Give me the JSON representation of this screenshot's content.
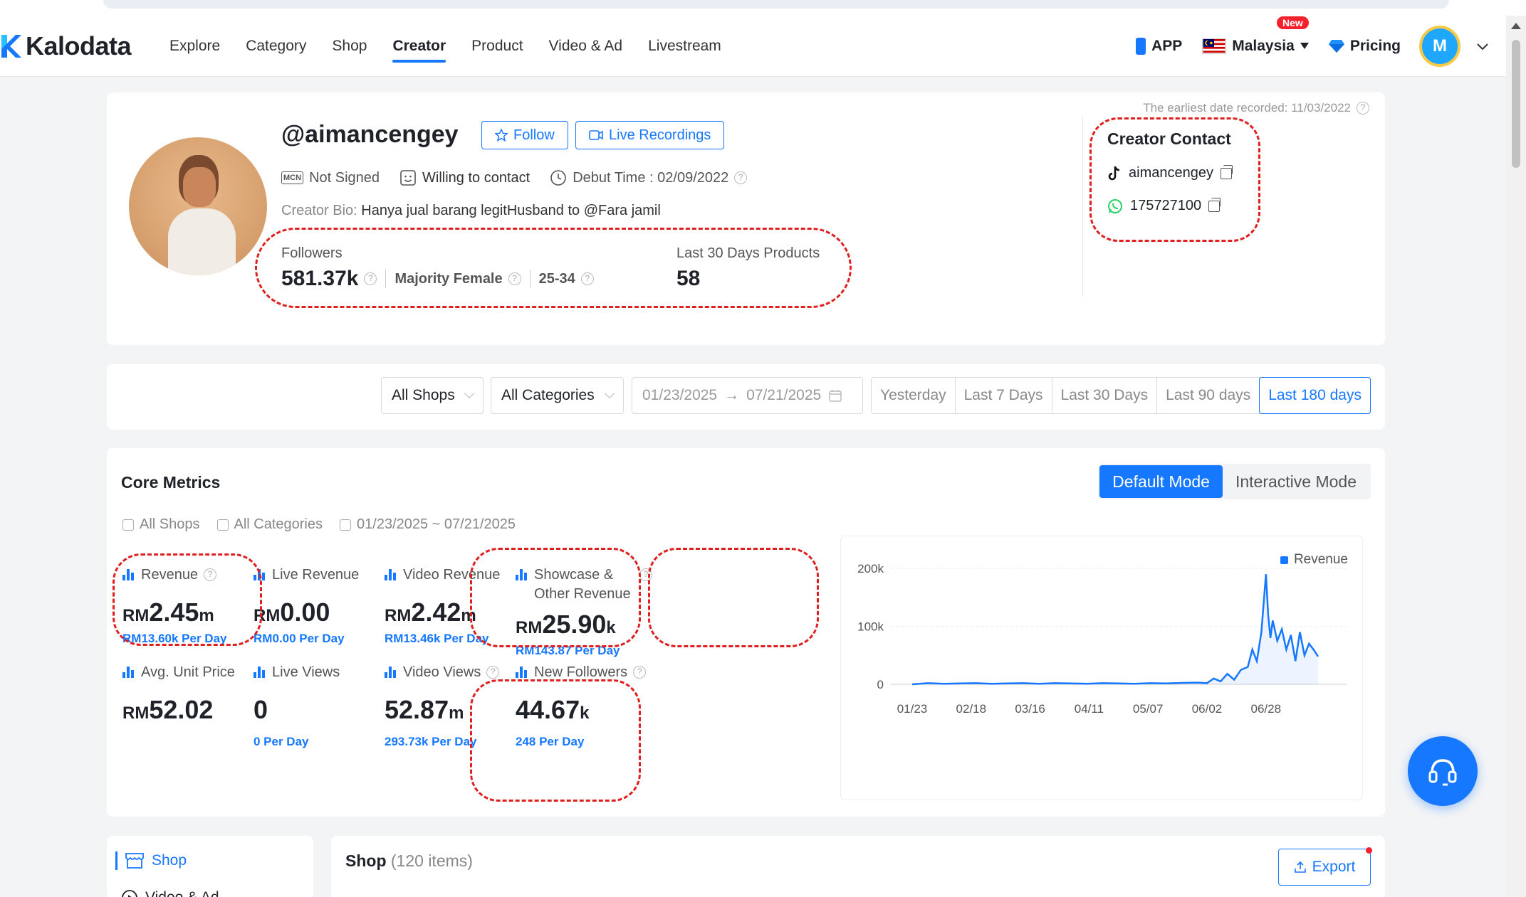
{
  "nav": {
    "brand": "Kalodata",
    "items": [
      "Explore",
      "Category",
      "Shop",
      "Creator",
      "Product",
      "Video & Ad",
      "Livestream"
    ],
    "active": "Creator",
    "app_label": "APP",
    "country": "Malaysia",
    "new_badge": "New",
    "pricing": "Pricing",
    "avatar_letter": "M",
    "colors": {
      "accent": "#1677ff",
      "badge": "#f5222d"
    }
  },
  "profile": {
    "handle": "@aimancengey",
    "follow_label": "Follow",
    "live_label": "Live Recordings",
    "mcn_icon": "MCN",
    "mcn_status": "Not Signed",
    "contact_status": "Willing to contact",
    "debut": "Debut Time : 02/09/2022",
    "bio_label": "Creator Bio:",
    "bio": "Hanya jual barang legitHusband to @Fara jamil",
    "followers_label": "Followers",
    "followers": "581.37k",
    "gender": "Majority Female",
    "age": "25-34",
    "products_label": "Last 30 Days Products",
    "products": "58",
    "earliest": "The earliest date recorded: 11/03/2022",
    "contact_title": "Creator Contact",
    "tiktok": "aimancengey",
    "whatsapp": "175727100"
  },
  "filters": {
    "shops": "All Shops",
    "categories": "All Categories",
    "date_start": "01/23/2025",
    "date_arrow": "→",
    "date_end": "07/21/2025",
    "ranges": [
      "Yesterday",
      "Last 7 Days",
      "Last 30 Days",
      "Last 90 days",
      "Last 180 days"
    ],
    "active_range": "Last 180 days"
  },
  "core": {
    "title": "Core Metrics",
    "modes": [
      "Default Mode",
      "Interactive Mode"
    ],
    "sub_shops": "All Shops",
    "sub_categories": "All Categories",
    "sub_date": "01/23/2025 ~ 07/21/2025",
    "metrics": [
      {
        "label": "Revenue",
        "prefix": "RM",
        "value": "2.45",
        "unit": "m",
        "per": "RM13.60k Per Day"
      },
      {
        "label": "Live Revenue",
        "prefix": "RM",
        "value": "0.00",
        "unit": "",
        "per": "RM0.00 Per Day"
      },
      {
        "label": "Video Revenue",
        "prefix": "RM",
        "value": "2.42",
        "unit": "m",
        "per": "RM13.46k Per Day"
      },
      {
        "label": "Showcase & Other Revenue",
        "prefix": "RM",
        "value": "25.90",
        "unit": "k",
        "per": "RM143.87 Per Day"
      },
      {
        "label": "Avg. Unit Price",
        "prefix": "RM",
        "value": "52.02",
        "unit": "",
        "per": ""
      },
      {
        "label": "Live Views",
        "prefix": "",
        "value": "0",
        "unit": "",
        "per": "0 Per Day"
      },
      {
        "label": "Video Views",
        "prefix": "",
        "value": "52.87",
        "unit": "m",
        "per": "293.73k Per Day"
      },
      {
        "label": "New Followers",
        "prefix": "",
        "value": "44.67",
        "unit": "k",
        "per": "248 Per Day"
      }
    ]
  },
  "chart_data": {
    "type": "area",
    "series": [
      {
        "name": "Revenue",
        "color": "#1677ff"
      }
    ],
    "x_ticks": [
      "01/23",
      "02/18",
      "03/16",
      "04/11",
      "05/07",
      "06/02",
      "06/28"
    ],
    "y_ticks": [
      "0",
      "100k",
      "200k"
    ],
    "ylim": [
      0,
      220000
    ],
    "x": [
      "01/23",
      "01/30",
      "02/06",
      "02/13",
      "02/20",
      "02/27",
      "03/06",
      "03/13",
      "03/20",
      "03/27",
      "04/03",
      "04/10",
      "04/17",
      "04/24",
      "05/01",
      "05/08",
      "05/15",
      "05/22",
      "05/29",
      "06/02",
      "06/05",
      "06/08",
      "06/11",
      "06/14",
      "06/17",
      "06/20",
      "06/22",
      "06/24",
      "06/26",
      "06/28",
      "06/29",
      "06/30",
      "07/01",
      "07/03",
      "07/05",
      "07/07",
      "07/09",
      "07/11",
      "07/13",
      "07/15",
      "07/17",
      "07/19",
      "07/21"
    ],
    "values": [
      0,
      2000,
      1000,
      1500,
      2000,
      1000,
      1500,
      2000,
      1000,
      2000,
      1500,
      1000,
      2000,
      1500,
      1000,
      2000,
      1500,
      2500,
      3000,
      2000,
      10000,
      5000,
      18000,
      8000,
      25000,
      30000,
      60000,
      40000,
      90000,
      190000,
      120000,
      80000,
      110000,
      75000,
      95000,
      60000,
      85000,
      40000,
      90000,
      50000,
      70000,
      60000,
      48000
    ]
  },
  "bottom": {
    "nav_shop": "Shop",
    "nav_video": "Video & Ad",
    "shop_title": "Shop",
    "shop_count": "(120 items)",
    "export": "Export"
  }
}
